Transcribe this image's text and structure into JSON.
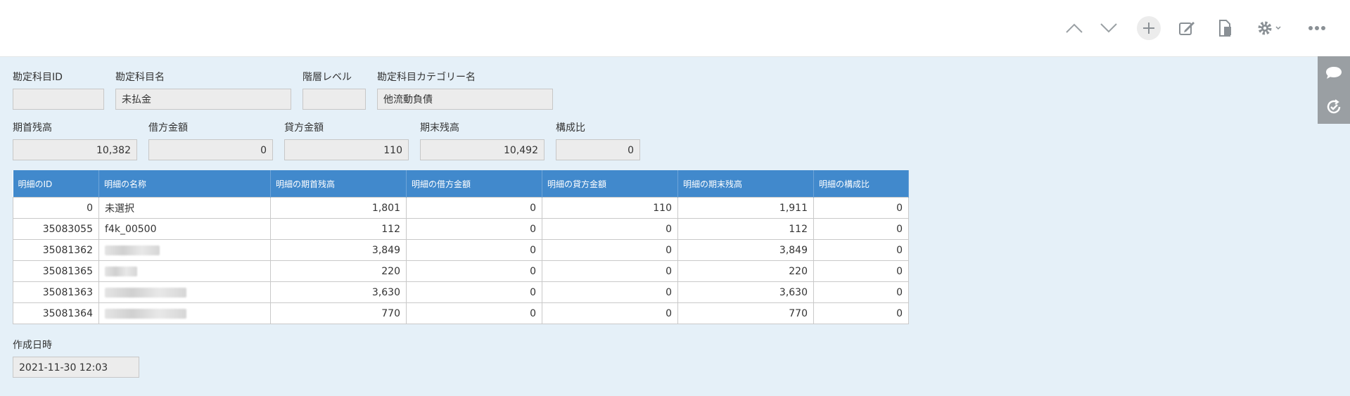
{
  "toolbar": {
    "icons": [
      "chevron-up-icon",
      "chevron-down-icon",
      "plus-icon",
      "edit-icon",
      "copy-icon",
      "gear-icon",
      "more-icon"
    ]
  },
  "fields": {
    "account_id": {
      "label": "勘定科目ID",
      "value": ""
    },
    "account_name": {
      "label": "勘定科目名",
      "value": "未払金"
    },
    "hierarchy_level": {
      "label": "階層レベル",
      "value": ""
    },
    "category_name": {
      "label": "勘定科目カテゴリー名",
      "value": "他流動負債"
    },
    "opening_balance": {
      "label": "期首残高",
      "value": "10,382"
    },
    "debit_amount": {
      "label": "借方金額",
      "value": "0"
    },
    "credit_amount": {
      "label": "貸方金額",
      "value": "110"
    },
    "closing_balance": {
      "label": "期末残高",
      "value": "10,492"
    },
    "composition_ratio": {
      "label": "構成比",
      "value": "0"
    },
    "created_at": {
      "label": "作成日時",
      "value": "2021-11-30 12:03"
    }
  },
  "table": {
    "headers": [
      "明細のID",
      "明細の名称",
      "明細の期首残高",
      "明細の借方金額",
      "明細の貸方金額",
      "明細の期末残高",
      "明細の構成比"
    ],
    "rows": [
      {
        "id": "0",
        "name": "未選択",
        "opening": "1,801",
        "debit": "0",
        "credit": "110",
        "closing": "1,911",
        "ratio": "0"
      },
      {
        "id": "35083055",
        "name": "f4k_00500",
        "opening": "112",
        "debit": "0",
        "credit": "0",
        "closing": "112",
        "ratio": "0"
      },
      {
        "id": "35081362",
        "name": "",
        "opening": "3,849",
        "debit": "0",
        "credit": "0",
        "closing": "3,849",
        "ratio": "0"
      },
      {
        "id": "35081365",
        "name": "",
        "opening": "220",
        "debit": "0",
        "credit": "0",
        "closing": "220",
        "ratio": "0"
      },
      {
        "id": "35081363",
        "name": "",
        "opening": "3,630",
        "debit": "0",
        "credit": "0",
        "closing": "3,630",
        "ratio": "0"
      },
      {
        "id": "35081364",
        "name": "",
        "opening": "770",
        "debit": "0",
        "credit": "0",
        "closing": "770",
        "ratio": "0"
      }
    ]
  },
  "side_panel": {
    "icons": [
      "comment-icon",
      "history-icon"
    ]
  }
}
